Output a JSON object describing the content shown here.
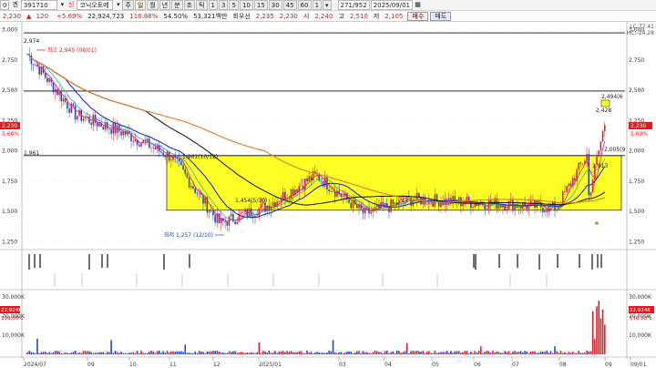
{
  "toolbar": {
    "screen_no": "0",
    "code_label": "겐",
    "code": "391710",
    "name_prefix": "신",
    "stock_name": "코닉오토메",
    "periods": [
      "주",
      "월",
      "년",
      "분",
      "초",
      "틱",
      "1",
      "3",
      "5",
      "10",
      "15",
      "30",
      "45",
      "60",
      "1",
      "▾"
    ],
    "selected_period": "일",
    "count": "271",
    "total": "952",
    "date": "2025/09/01"
  },
  "quote": {
    "price": "2,230",
    "change": "120",
    "change_pct": "+5.69%",
    "volume": "22,924,723",
    "volume_ratio": "116.88%",
    "turnover_pct": "54.50%",
    "amount": "53,321백만",
    "shares_label": "회우선",
    "open_label": "2,235",
    "close_label": "2,230",
    "open_text": "시",
    "open_value": "2,240",
    "high_text": "고",
    "high_value": "2,510",
    "low_text": "저",
    "low_value": "2,105",
    "buy_label": "매수",
    "sell_label": "매도"
  },
  "legend": {
    "line1": "LC:77.41",
    "line2": "HC:-24.28"
  },
  "price_panel": {
    "y_ticks": [
      "3,000",
      "2,750",
      "2,500",
      "2,250",
      "2,000",
      "1,750",
      "1,500",
      "1,250"
    ],
    "left_tags": [
      "2,230",
      "5.69%"
    ],
    "right_tags": [
      "2,230",
      "5.69%"
    ]
  },
  "annotations": {
    "high_label": "최고 2,945 (08/01)",
    "low_label": "최저 1,257 (12/10)",
    "level_2974": "2,974",
    "level_1961": "1,961",
    "box_label": "1,961(10/12)",
    "mid_label": "1,454(5/30)",
    "label_2494": "2,494(6",
    "label_2428": "2,428",
    "label_2005": "2,005(9",
    "label_1913": "1,913",
    "label_2447": "2,447"
  },
  "volume_panel": {
    "y_ticks": [
      "30,000K",
      "20,000K",
      "10,000K"
    ],
    "left_tags": [
      "22,924K",
      "116.88%"
    ],
    "right_tags": [
      "22,924K",
      "116.88%"
    ]
  },
  "x_axis": {
    "labels": [
      "2024/07",
      "09",
      "10",
      "11",
      "12",
      "2025/01",
      "03",
      "04",
      "05",
      "06",
      "07",
      "08",
      "09",
      "09/01"
    ]
  },
  "colors": {
    "up": "#e5171e",
    "down": "#1446c8",
    "zone": "#ffff26",
    "ma5": "#e0178c",
    "ma20": "#1f35c0",
    "ma60": "#e27a1e",
    "ma120": "#111111",
    "ma_teal": "#19a79a"
  },
  "chart_data": {
    "type": "line",
    "title": "",
    "ylim": [
      1200,
      3050
    ],
    "x": [
      "2024/07",
      "09",
      "10",
      "11",
      "12",
      "2025/01",
      "03",
      "04",
      "05",
      "06",
      "07",
      "08",
      "09"
    ],
    "series": [
      {
        "values": [
          2800,
          2300,
          2150,
          1950,
          1400,
          1550,
          1800,
          1480,
          1600,
          1580,
          1560,
          1530,
          2230
        ]
      }
    ],
    "horizontal_lines": [
      2974,
      2494,
      1961
    ],
    "zone": [
      1510,
      1961
    ]
  }
}
